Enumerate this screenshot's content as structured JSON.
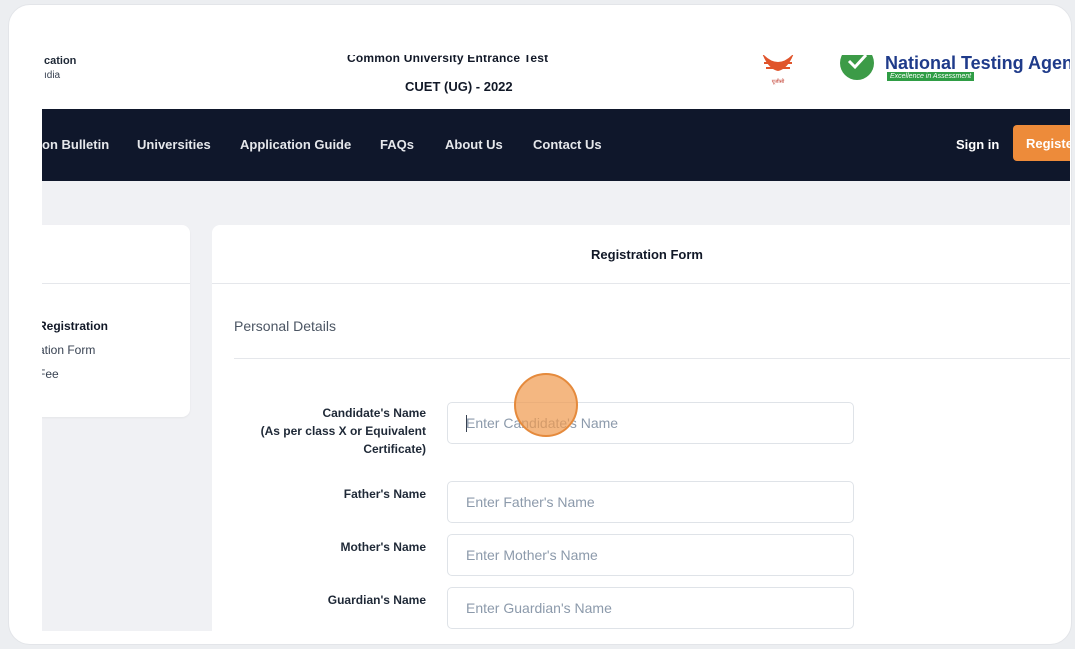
{
  "header": {
    "ministry_line1": "cation",
    "ministry_line2": "ıdia",
    "exam_name": "Common University Entrance Test",
    "exam_code": "CUET (UG) - 2022",
    "nta_title": "National Testing Agen",
    "nta_tagline": "Excellence in Assessment"
  },
  "nav": {
    "items": [
      "on Bulletin",
      "Universities",
      "Application Guide",
      "FAQs",
      "About Us",
      "Contact Us"
    ],
    "signin": "Sign in",
    "register": "Registe"
  },
  "sidebar": {
    "steps": [
      "Registration",
      "ation Form",
      "Fee"
    ]
  },
  "form": {
    "title": "Registration Form",
    "section": "Personal Details",
    "candidate_label_1": "Candidate's Name",
    "candidate_label_2": "(As per class X or Equivalent",
    "candidate_label_3": "Certificate)",
    "candidate_placeholder": "Enter Candidate's Name",
    "father_label": "Father's Name",
    "father_placeholder": "Enter Father's Name",
    "mother_label": "Mother's Name",
    "mother_placeholder": "Enter Mother's Name",
    "guardian_label": "Guardian's Name",
    "guardian_placeholder": "Enter Guardian's Name"
  },
  "colors": {
    "navbar_bg": "#0f172b",
    "accent_orange": "#ed8b3a",
    "nta_blue": "#1f3b8a",
    "nta_green": "#2f9d45"
  }
}
